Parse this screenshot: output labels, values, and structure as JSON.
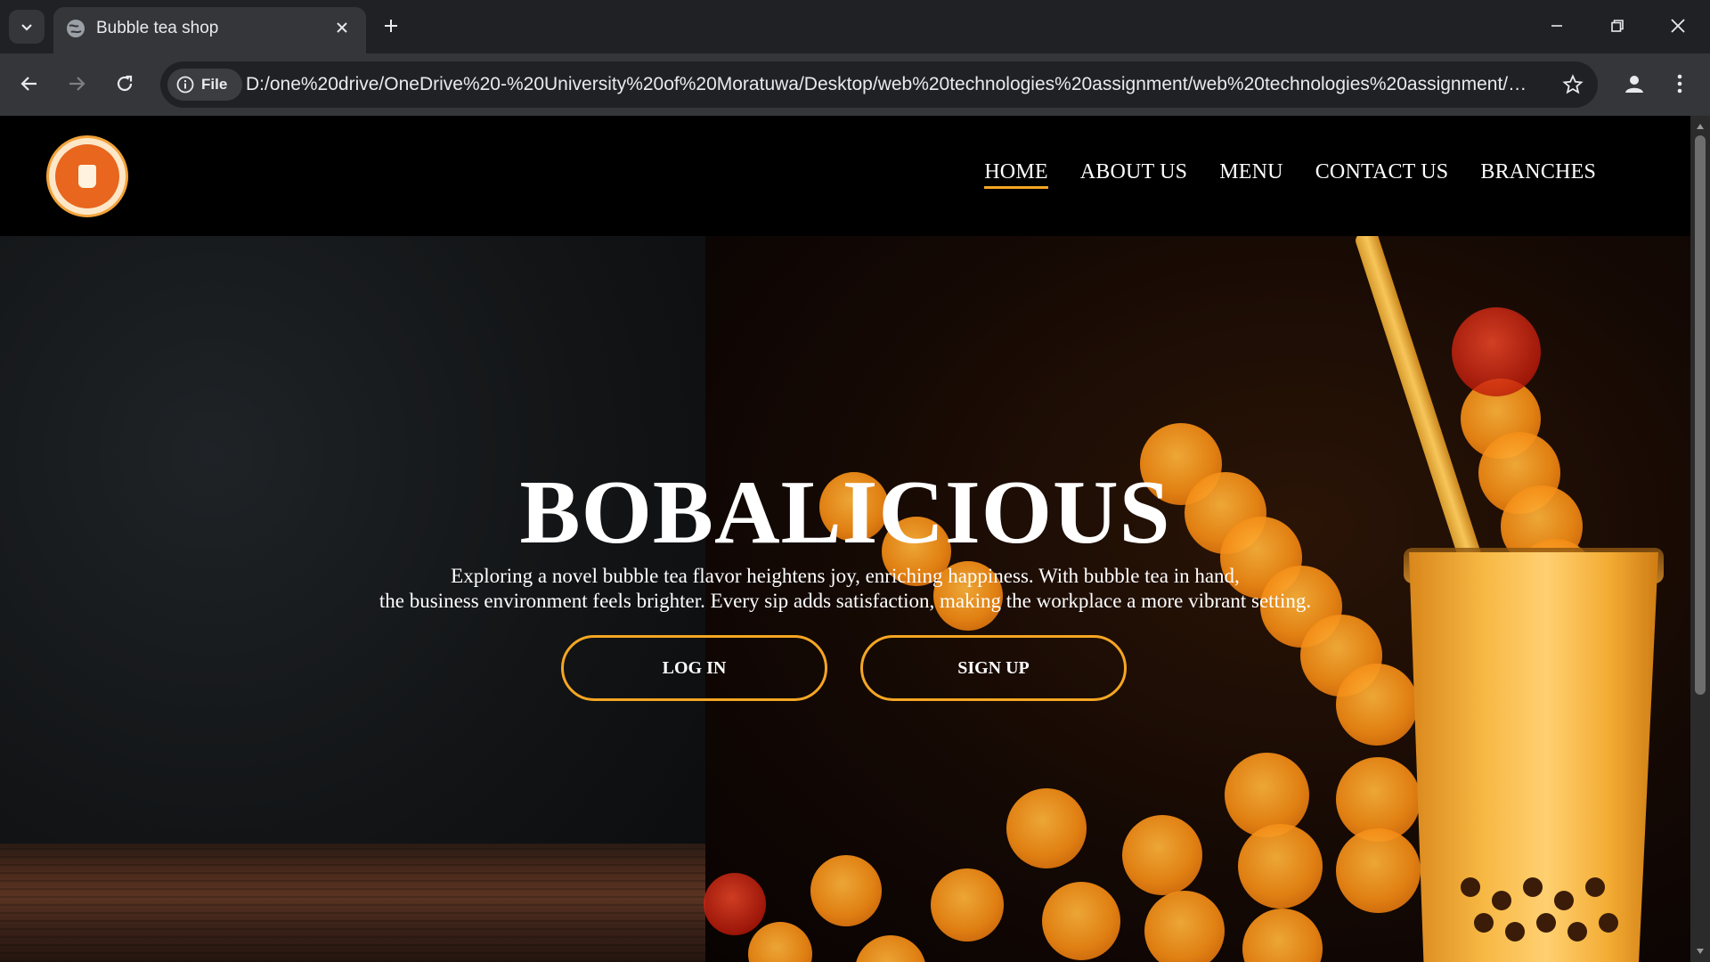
{
  "browser": {
    "tab_title": "Bubble tea shop",
    "site_chip_label": "File",
    "url": "D:/one%20drive/OneDrive%20-%20University%20of%20Moratuwa/Desktop/web%20technologies%20assignment/web%20technologies%20assignment/w..."
  },
  "header": {
    "logo_name": "bobalicious-logo",
    "nav": [
      {
        "label": "HOME",
        "active": true
      },
      {
        "label": "ABOUT US",
        "active": false
      },
      {
        "label": "MENU",
        "active": false
      },
      {
        "label": "CONTACT US",
        "active": false
      },
      {
        "label": "BRANCHES",
        "active": false
      }
    ]
  },
  "hero": {
    "title": "BOBALICIOUS",
    "line1": "Exploring a novel bubble tea flavor heightens joy, enriching happiness. With bubble tea in hand,",
    "line2": "the business environment feels brighter. Every sip adds satisfaction, making the workplace a more vibrant setting.",
    "login_label": "LOG IN",
    "signup_label": "SIGN UP"
  },
  "colors": {
    "accent": "#f5a623",
    "header_bg": "#000000",
    "chrome_bg": "#202124",
    "toolbar_bg": "#35363a"
  }
}
